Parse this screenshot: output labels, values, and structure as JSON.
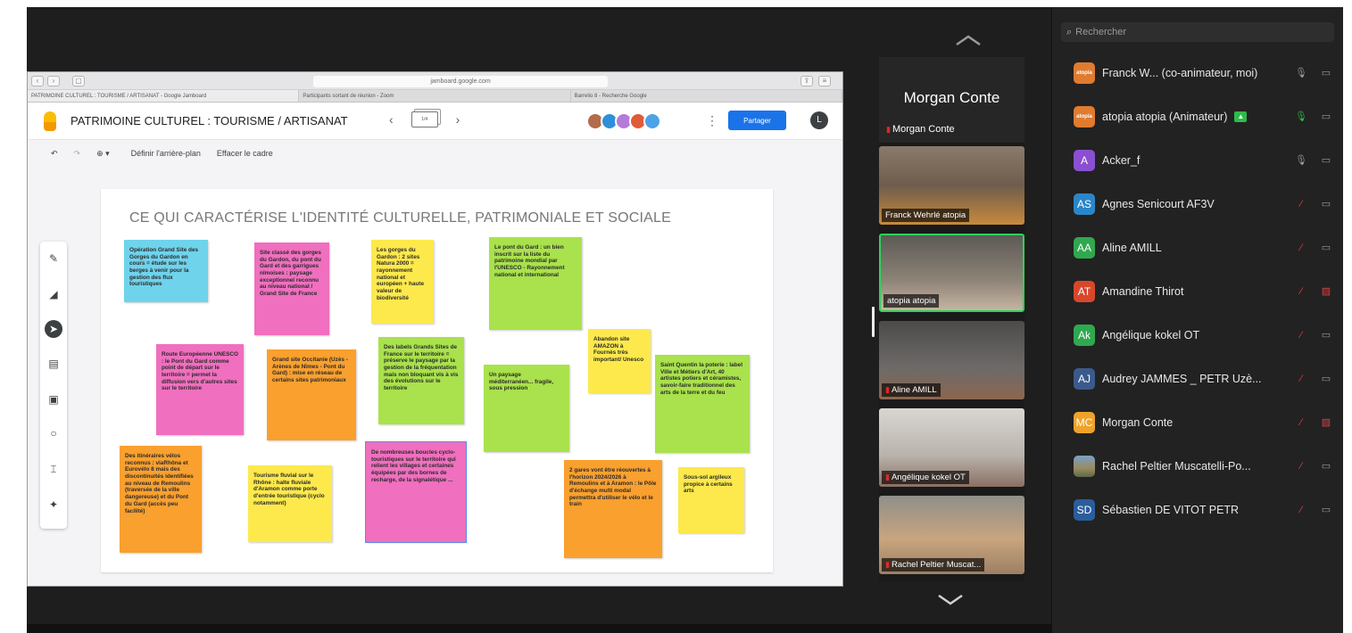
{
  "browser": {
    "address": "jamboard.google.com",
    "tabs": [
      "PATRIMOINE CULTUREL : TOURISME / ARTISANAT - Google Jamboard",
      "Participants sortant de réunion - Zoom",
      "Barrelio 8 - Recherche Google"
    ]
  },
  "jamboard": {
    "title": "PATRIMOINE CULTUREL : TOURISME / ARTISANAT",
    "frame_indicator": "1/4",
    "share_label": "Partager",
    "account_initial": "L",
    "set_background_label": "Définir l'arrière-plan",
    "clear_frame_label": "Effacer le cadre",
    "board_title": "CE QUI CARACTÉRISE L'IDENTITÉ CULTURELLE, PATRIMONIALE ET SOCIALE",
    "notes": [
      {
        "text": "Opération Grand Site des Gorges du Gardon en cours = étude sur les berges à venir pour la gestion des flux touristiques",
        "color": "#6fd3ec"
      },
      {
        "text": "Site classé des gorges du Gardon, du pont du Gard et des garrigues nîmoises : paysage exceptionnel reconnu au niveau national / Grand Site de France",
        "color": "#f06fbf"
      },
      {
        "text": "Les gorges du Gardon : 2 sites Natura 2000 = rayonnement national et européen + haute valeur de biodiversité",
        "color": "#fde94c"
      },
      {
        "text": "Le pont du Gard : un bien inscrit sur la liste du patrimoine mondial par l'UNESCO - Rayonnement national et international",
        "color": "#a9e24c"
      },
      {
        "text": "Route Européenne UNESCO : le Pont du Gard comme point de départ sur le territoire = permet la diffusion vers d'autres sites sur le territoire",
        "color": "#f06fbf"
      },
      {
        "text": "Grand site Occitanie (Uzès - Arènes de Nîmes - Pont du Gard) : mise en réseau de certains sites patrimoniaux",
        "color": "#f9a02f"
      },
      {
        "text": "Des labels Grands Sites de France sur le territoire = préserve le paysage par la gestion de la fréquentation mais non bloquant vis à vis des évolutions sur le territoire",
        "color": "#a9e24c"
      },
      {
        "text": "Abandon site AMAZON à Fournès très important/ Unesco",
        "color": "#fde94c"
      },
      {
        "text": "Un paysage méditerranéen... fragile, sous pression",
        "color": "#a9e24c"
      },
      {
        "text": "Saint Quentin la poterie : label Ville et Métiers d'Art, 40 artistes potiers et céramistes, savoir-faire traditionnel des arts de la terre et du feu",
        "color": "#a9e24c"
      },
      {
        "text": "Des itinéraires vélos reconnus : viaRhôna et Eurovélo 8 mais des discontinuités identifiées au niveau de Remoulins (traversée de la ville dangereuse) et du Pont du Gard (accès peu facilité)",
        "color": "#f9a02f"
      },
      {
        "text": "Tourisme fluvial sur le Rhône : halte fluviale d'Aramon comme porte d'entrée touristique (cyclo notamment)",
        "color": "#fde94c"
      },
      {
        "text": "De nombreuses boucles cyclo-touristiques sur le territoire qui relient les villages et certaines équipées par des bornes de recharge, de la signalétique ...",
        "color": "#f06fbf"
      },
      {
        "text": "2 gares vont être réouvertes à l'horizon 2024/2026 à Remoulins et à Aramon : le Pôle d'échange multi modal permettra d'utiliser le vélo et le train",
        "color": "#f9a02f"
      },
      {
        "text": "Sous-sol argileux propice à certains arts",
        "color": "#fde94c"
      }
    ]
  },
  "gallery": {
    "speaker_name": "Morgan Conte",
    "speaker_label": "Morgan Conte",
    "tiles": [
      {
        "name": "Franck Wehrlé atopia",
        "muted": false,
        "bg": "#6e5d4c"
      },
      {
        "name": "atopia atopia",
        "muted": false,
        "bg": "#8d8377"
      },
      {
        "name": "Aline AMILL",
        "muted": true,
        "bg": "#6d6a68"
      },
      {
        "name": "Angélique kokel OT",
        "muted": true,
        "bg": "#8b6f62"
      },
      {
        "name": "Rachel Peltier Muscat...",
        "muted": true,
        "bg": "#9c7f64"
      }
    ]
  },
  "participants": {
    "search_placeholder": "Rechercher",
    "items": [
      {
        "initials": "atopia",
        "name": "Franck W... (co-animateur, moi)",
        "color": "#e07b2f",
        "mic_off": false,
        "cam_off": false,
        "badge": false
      },
      {
        "initials": "atopia",
        "name": "atopia atopia (Animateur)",
        "color": "#e07b2f",
        "mic_off": false,
        "cam_off": false,
        "badge": true
      },
      {
        "initials": "A",
        "name": "Acker_f",
        "color": "#8b4fd1",
        "mic_off": false,
        "cam_off": false,
        "badge": false
      },
      {
        "initials": "AS",
        "name": "Agnes Senicourt AF3V",
        "color": "#2a86c9",
        "mic_off": true,
        "cam_off": false,
        "badge": false
      },
      {
        "initials": "AA",
        "name": "Aline AMILL",
        "color": "#2fa84f",
        "mic_off": true,
        "cam_off": false,
        "badge": false
      },
      {
        "initials": "AT",
        "name": "Amandine Thirot",
        "color": "#d9472b",
        "mic_off": true,
        "cam_off": true,
        "badge": false
      },
      {
        "initials": "Ak",
        "name": "Angélique kokel OT",
        "color": "#2fa84f",
        "mic_off": true,
        "cam_off": false,
        "badge": false
      },
      {
        "initials": "AJ",
        "name": "Audrey JAMMES _ PETR Uzè...",
        "color": "#3a5a8c",
        "mic_off": true,
        "cam_off": false,
        "badge": false
      },
      {
        "initials": "MC",
        "name": "Morgan Conte",
        "color": "#f0a32a",
        "mic_off": true,
        "cam_off": true,
        "badge": false
      },
      {
        "initials": "",
        "name": "Rachel Peltier Muscatelli-Po...",
        "color": "#5a7a9a",
        "mic_off": true,
        "cam_off": false,
        "badge": false
      },
      {
        "initials": "SD",
        "name": "Sébastien DE VITOT PETR",
        "color": "#2a5d9c",
        "mic_off": true,
        "cam_off": false,
        "badge": false
      }
    ]
  }
}
